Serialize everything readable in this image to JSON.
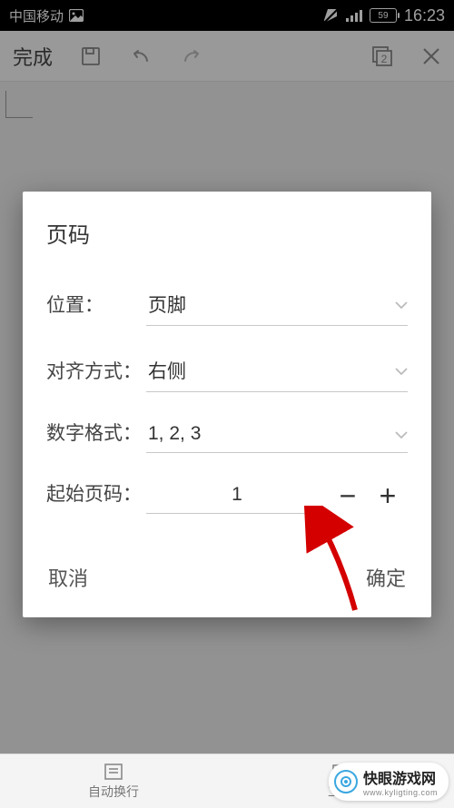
{
  "status": {
    "carrier": "中国移动",
    "battery_pct": "59",
    "time": "16:23"
  },
  "editor_toolbar": {
    "done_label": "完成",
    "page_indicator": "2"
  },
  "dialog": {
    "title": "页码",
    "position": {
      "label": "位置：",
      "value": "页脚"
    },
    "align": {
      "label": "对齐方式：",
      "value": "右侧"
    },
    "format": {
      "label": "数字格式：",
      "value": "1, 2, 3"
    },
    "start": {
      "label": "起始页码：",
      "value": "1"
    },
    "cancel_label": "取消",
    "confirm_label": "确定"
  },
  "bottom_nav": {
    "wrap_label": "自动换行",
    "tools_label": "工具"
  },
  "watermark": {
    "text": "快眼游戏网",
    "url": "www.kyligting.com"
  }
}
